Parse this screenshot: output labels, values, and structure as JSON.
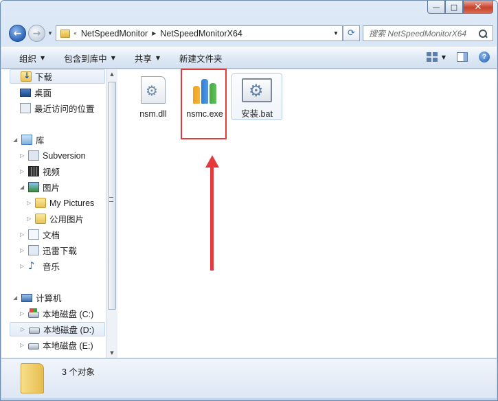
{
  "window": {
    "caption_buttons": {
      "minimize": "—",
      "maximize": "□",
      "close": "✕"
    }
  },
  "nav": {
    "back_glyph": "←",
    "forward_glyph": "→",
    "breadcrumb_overflow": "«",
    "breadcrumb": [
      "NetSpeedMonitor",
      "NetSpeedMonitorX64"
    ],
    "refresh_glyph": "⟳"
  },
  "search": {
    "placeholder": "搜索 NetSpeedMonitorX64"
  },
  "toolbar": {
    "organize": "组织",
    "include_in_library": "包含到库中",
    "share": "共享",
    "new_folder": "新建文件夹",
    "help_glyph": "?"
  },
  "sidebar": {
    "items": [
      {
        "label": "下载",
        "icon": "downloads-folder-icon"
      },
      {
        "label": "桌面",
        "icon": "desktop-icon"
      },
      {
        "label": "最近访问的位置",
        "icon": "recent-places-icon"
      },
      {
        "label": "库",
        "icon": "library-icon"
      },
      {
        "label": "Subversion",
        "icon": "subversion-icon"
      },
      {
        "label": "视频",
        "icon": "video-library-icon"
      },
      {
        "label": "图片",
        "icon": "pictures-library-icon"
      },
      {
        "label": "My Pictures",
        "icon": "folder-icon"
      },
      {
        "label": "公用图片",
        "icon": "folder-icon"
      },
      {
        "label": "文档",
        "icon": "documents-library-icon"
      },
      {
        "label": "迅雷下载",
        "icon": "thunder-download-icon"
      },
      {
        "label": "音乐",
        "icon": "music-library-icon"
      },
      {
        "label": "计算机",
        "icon": "computer-icon"
      },
      {
        "label": "本地磁盘 (C:)",
        "icon": "system-drive-icon"
      },
      {
        "label": "本地磁盘 (D:)",
        "icon": "drive-icon"
      },
      {
        "label": "本地磁盘 (E:)",
        "icon": "drive-icon"
      }
    ]
  },
  "files": [
    {
      "name": "nsm.dll",
      "icon": "dll-file-icon"
    },
    {
      "name": "nsmc.exe",
      "icon": "nsmc-app-icon"
    },
    {
      "name": "安装.bat",
      "icon": "batch-file-icon"
    }
  ],
  "exe_bar_colors": [
    "#f0a316",
    "#2a7fd8",
    "#3fae3b"
  ],
  "annotation_color": "#e5393e",
  "details": {
    "count_text": "3 个对象"
  }
}
